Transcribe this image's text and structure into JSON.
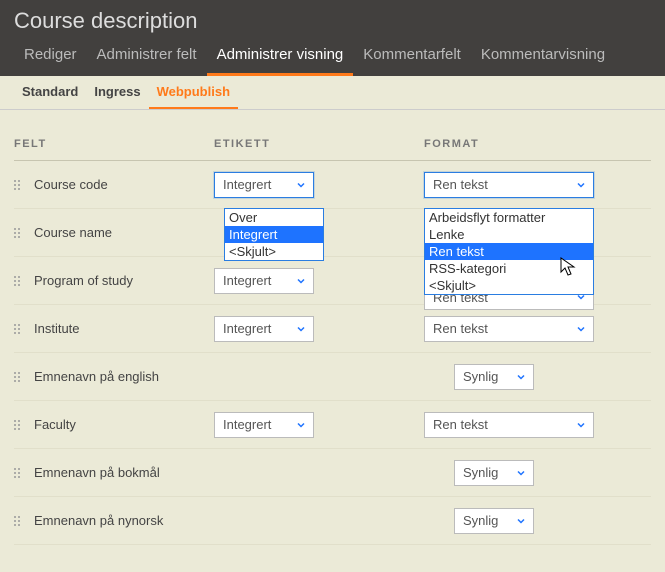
{
  "header": {
    "title": "Course description",
    "tabs": [
      "Rediger",
      "Administrer felt",
      "Administrer visning",
      "Kommentarfelt",
      "Kommentarvisning"
    ],
    "active_tab": 2
  },
  "subtabs": {
    "tabs": [
      "Standard",
      "Ingress",
      "Webpublish"
    ],
    "active": 2
  },
  "columns": {
    "felt": "FELT",
    "etikett": "ETIKETT",
    "format": "FORMAT"
  },
  "etikett_dropdown": {
    "value": "Integrert",
    "options": [
      "Over",
      "Integrert",
      "<Skjult>"
    ],
    "selected_index": 1
  },
  "format_dropdown": {
    "value": "Ren tekst",
    "options": [
      "Arbeidsflyt formatter",
      "Lenke",
      "Ren tekst",
      "RSS-kategori",
      "<Skjult>"
    ],
    "selected_index": 2
  },
  "rows": [
    {
      "name": "Course code",
      "etikett": "Integrert",
      "format": "Ren tekst",
      "etikett_open": true,
      "format_open": true
    },
    {
      "name": "Course name",
      "etikett": null,
      "format": null
    },
    {
      "name": "Program of study",
      "etikett": "Integrert",
      "format": "Ren tekst"
    },
    {
      "name": "Institute",
      "etikett": "Integrert",
      "format": "Ren tekst"
    },
    {
      "name": "Emnenavn på english",
      "etikett": null,
      "format": "Synlig",
      "narrow": true
    },
    {
      "name": "Faculty",
      "etikett": "Integrert",
      "format": "Ren tekst"
    },
    {
      "name": "Emnenavn på bokmål",
      "etikett": null,
      "format": "Synlig",
      "narrow": true
    },
    {
      "name": "Emnenavn på nynorsk",
      "etikett": null,
      "format": "Synlig",
      "narrow": true
    }
  ]
}
